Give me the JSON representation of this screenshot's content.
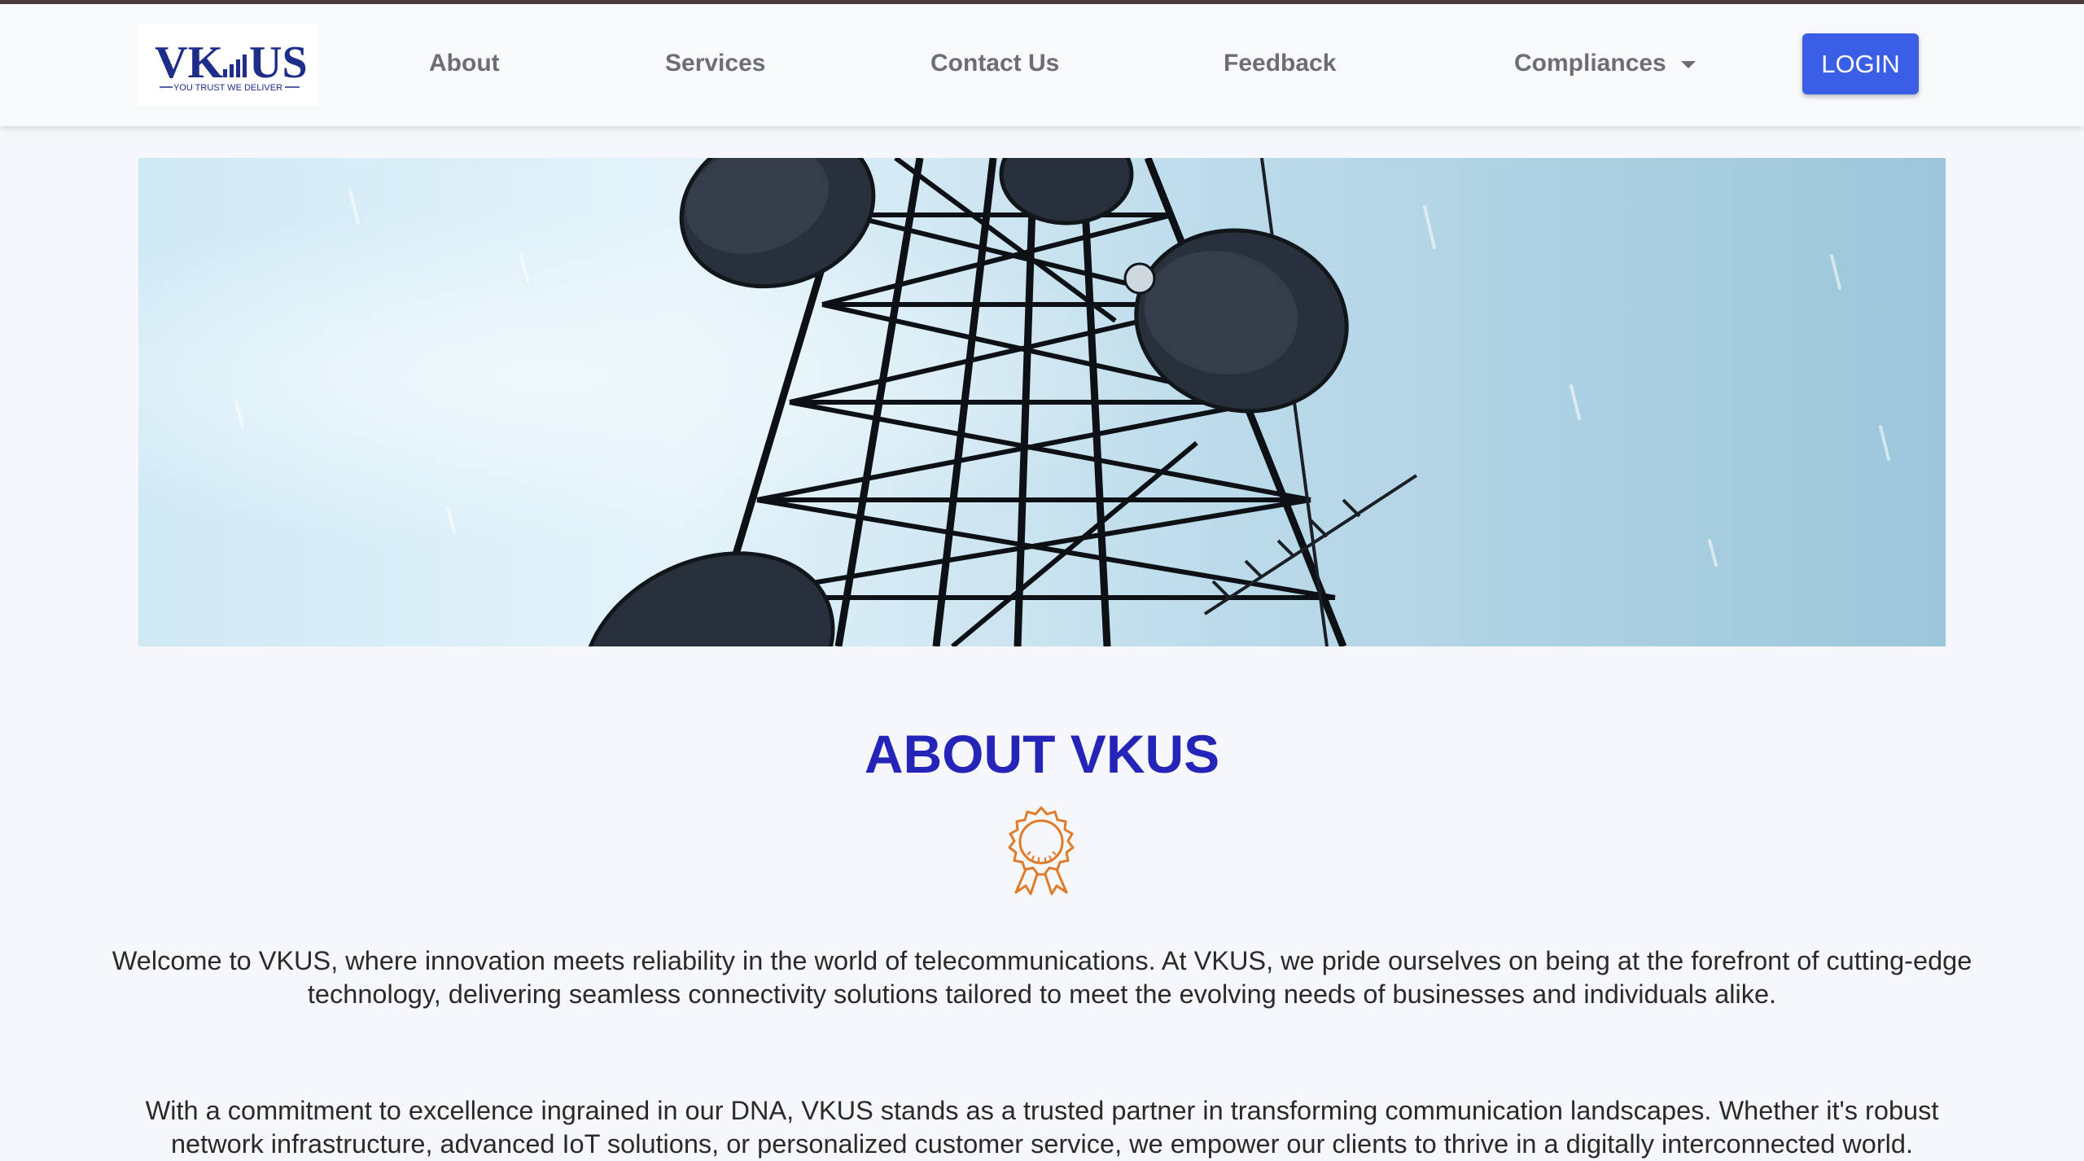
{
  "brand": {
    "logo_text": "VKUS",
    "tagline": "YOU TRUST WE DELIVER"
  },
  "nav": {
    "about": "About",
    "services": "Services",
    "contact": "Contact Us",
    "feedback": "Feedback",
    "compliances": "Compliances",
    "login": "LOGIN"
  },
  "hero": {
    "image": "telecom-tower-image"
  },
  "about": {
    "title": "ABOUT VKUS",
    "icon": "award-ribbon-icon",
    "paragraph1": "Welcome to VKUS, where innovation meets reliability in the world of telecommunications. At VKUS, we pride ourselves on being at the forefront of cutting-edge technology, delivering seamless connectivity solutions tailored to meet the evolving needs of businesses and individuals alike.",
    "paragraph2": "With a commitment to excellence ingrained in our DNA, VKUS stands as a trusted partner in transforming communication landscapes. Whether it's robust network infrastructure, advanced IoT solutions, or personalized customer service, we empower our clients to thrive in a digitally interconnected world."
  },
  "colors": {
    "accent": "#3a5ee6",
    "title": "#2424b8",
    "icon": "#e07b2a",
    "logo": "#1f2d8a"
  }
}
